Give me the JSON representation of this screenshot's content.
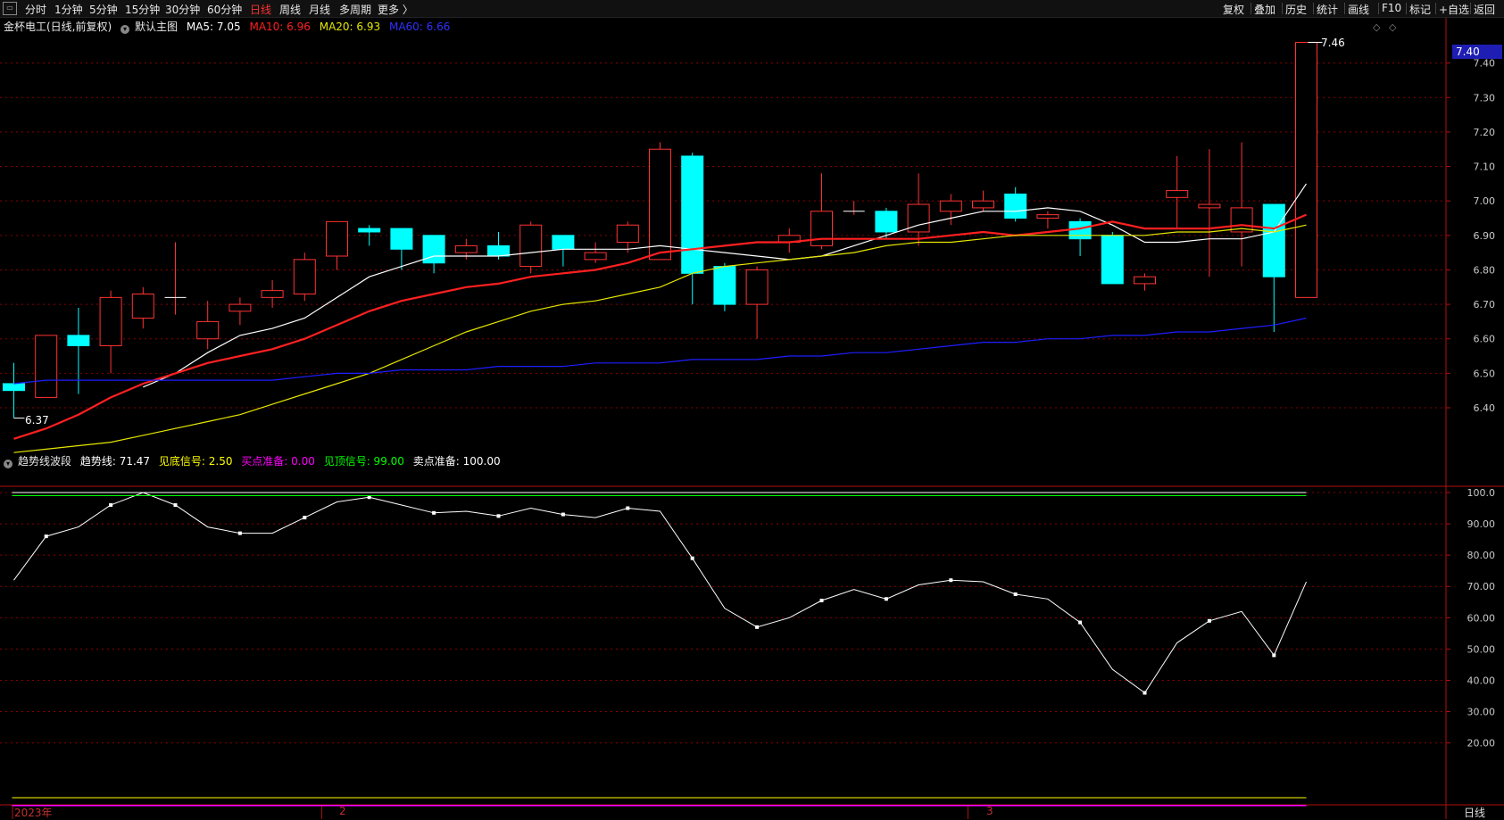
{
  "toolbar": {
    "periods": [
      "分时",
      "1分钟",
      "5分钟",
      "15分钟",
      "30分钟",
      "60分钟",
      "日线",
      "周线",
      "月线",
      "多周期",
      "更多 〉"
    ],
    "active_period": "日线",
    "right_tools": [
      "复权",
      "叠加",
      "历史",
      "统计",
      "画线",
      "F10",
      "标记",
      "+自选",
      "返回"
    ]
  },
  "main_legend": {
    "title": "金杯电工(日线,前复权)",
    "template": "默认主图",
    "ma5": "MA5: 7.05",
    "ma10": "MA10: 6.96",
    "ma20": "MA20: 6.93",
    "ma60": "MA60: 6.66"
  },
  "sub_legend": {
    "name": "趋势线波段",
    "trend": "趋势线: 71.47",
    "bottom_signal": "见底信号: 2.50",
    "buy_prep": "买点准备: 0.00",
    "top_signal": "见顶信号: 99.00",
    "sell_prep": "卖点准备: 100.00"
  },
  "axis": {
    "date_labels": [
      "2023年",
      "2",
      "3"
    ],
    "period_label": "日线",
    "price_badge": "7.40",
    "high_label": "7.46",
    "low_label": "6.37"
  },
  "colors": {
    "up": "#ff3232",
    "down": "#00ffff",
    "ma5": "#ffffff",
    "ma10": "#ff2020",
    "ma20": "#e6e600",
    "ma60": "#1e1eff",
    "grid": "#8b0000",
    "trend": "#ffffff",
    "bottom_signal": "#ffff00",
    "buy_prep": "#ff00ff",
    "top_signal": "#00ff00",
    "sell_prep": "#ffffff"
  },
  "chart_data": [
    {
      "type": "candlestick",
      "ylim": [
        6.18,
        7.5
      ],
      "yticks": [
        "7.40",
        "7.30",
        "7.20",
        "7.10",
        "7.00",
        "6.90",
        "6.80",
        "6.70",
        "6.60",
        "6.50",
        "6.40"
      ],
      "candles": [
        {
          "o": 6.47,
          "h": 6.53,
          "l": 6.37,
          "c": 6.45
        },
        {
          "o": 6.43,
          "h": 6.61,
          "l": 6.43,
          "c": 6.61
        },
        {
          "o": 6.61,
          "h": 6.69,
          "l": 6.44,
          "c": 6.58
        },
        {
          "o": 6.58,
          "h": 6.74,
          "l": 6.5,
          "c": 6.72
        },
        {
          "o": 6.66,
          "h": 6.75,
          "l": 6.63,
          "c": 6.73
        },
        {
          "o": 6.72,
          "h": 6.88,
          "l": 6.67,
          "c": 6.72
        },
        {
          "o": 6.6,
          "h": 6.71,
          "l": 6.57,
          "c": 6.65
        },
        {
          "o": 6.68,
          "h": 6.72,
          "l": 6.64,
          "c": 6.7
        },
        {
          "o": 6.72,
          "h": 6.77,
          "l": 6.69,
          "c": 6.74
        },
        {
          "o": 6.73,
          "h": 6.85,
          "l": 6.71,
          "c": 6.83
        },
        {
          "o": 6.84,
          "h": 6.94,
          "l": 6.8,
          "c": 6.94
        },
        {
          "o": 6.92,
          "h": 6.93,
          "l": 6.87,
          "c": 6.91
        },
        {
          "o": 6.92,
          "h": 6.92,
          "l": 6.8,
          "c": 6.86
        },
        {
          "o": 6.9,
          "h": 6.9,
          "l": 6.79,
          "c": 6.82
        },
        {
          "o": 6.85,
          "h": 6.89,
          "l": 6.83,
          "c": 6.87
        },
        {
          "o": 6.87,
          "h": 6.91,
          "l": 6.83,
          "c": 6.84
        },
        {
          "o": 6.81,
          "h": 6.94,
          "l": 6.79,
          "c": 6.93
        },
        {
          "o": 6.9,
          "h": 6.9,
          "l": 6.81,
          "c": 6.86
        },
        {
          "o": 6.83,
          "h": 6.88,
          "l": 6.82,
          "c": 6.85
        },
        {
          "o": 6.88,
          "h": 6.94,
          "l": 6.85,
          "c": 6.93
        },
        {
          "o": 6.83,
          "h": 7.17,
          "l": 6.83,
          "c": 7.15
        },
        {
          "o": 7.13,
          "h": 7.14,
          "l": 6.7,
          "c": 6.79
        },
        {
          "o": 6.81,
          "h": 6.82,
          "l": 6.68,
          "c": 6.7
        },
        {
          "o": 6.7,
          "h": 6.81,
          "l": 6.6,
          "c": 6.8
        },
        {
          "o": 6.88,
          "h": 6.92,
          "l": 6.85,
          "c": 6.9
        },
        {
          "o": 6.87,
          "h": 7.08,
          "l": 6.86,
          "c": 6.97
        },
        {
          "o": 6.97,
          "h": 7.0,
          "l": 6.96,
          "c": 6.97
        },
        {
          "o": 6.97,
          "h": 6.98,
          "l": 6.89,
          "c": 6.91
        },
        {
          "o": 6.91,
          "h": 7.08,
          "l": 6.87,
          "c": 6.99
        },
        {
          "o": 6.97,
          "h": 7.02,
          "l": 6.93,
          "c": 7.0
        },
        {
          "o": 6.98,
          "h": 7.03,
          "l": 6.97,
          "c": 7.0
        },
        {
          "o": 7.02,
          "h": 7.04,
          "l": 6.94,
          "c": 6.95
        },
        {
          "o": 6.95,
          "h": 6.97,
          "l": 6.92,
          "c": 6.96
        },
        {
          "o": 6.94,
          "h": 6.95,
          "l": 6.84,
          "c": 6.89
        },
        {
          "o": 6.9,
          "h": 6.91,
          "l": 6.76,
          "c": 6.76
        },
        {
          "o": 6.76,
          "h": 6.79,
          "l": 6.74,
          "c": 6.78
        },
        {
          "o": 7.01,
          "h": 7.13,
          "l": 6.92,
          "c": 7.03
        },
        {
          "o": 6.98,
          "h": 7.15,
          "l": 6.78,
          "c": 6.99
        },
        {
          "o": 6.91,
          "h": 7.17,
          "l": 6.81,
          "c": 6.98
        },
        {
          "o": 6.99,
          "h": 6.99,
          "l": 6.62,
          "c": 6.78
        },
        {
          "o": 6.72,
          "h": 7.46,
          "l": 6.72,
          "c": 7.46
        }
      ],
      "series": [
        {
          "name": "MA5",
          "values": [
            null,
            null,
            null,
            null,
            6.46,
            6.5,
            6.56,
            6.61,
            6.63,
            6.66,
            6.72,
            6.78,
            6.81,
            6.84,
            6.84,
            6.84,
            6.85,
            6.86,
            6.86,
            6.86,
            6.87,
            6.86,
            6.85,
            6.84,
            6.83,
            6.84,
            6.87,
            6.9,
            6.93,
            6.95,
            6.97,
            6.97,
            6.98,
            6.97,
            6.93,
            6.88,
            6.88,
            6.89,
            6.89,
            6.91,
            7.05
          ]
        },
        {
          "name": "MA10",
          "values": [
            6.31,
            6.34,
            6.38,
            6.43,
            6.47,
            6.5,
            6.53,
            6.55,
            6.57,
            6.6,
            6.64,
            6.68,
            6.71,
            6.73,
            6.75,
            6.76,
            6.78,
            6.79,
            6.8,
            6.82,
            6.85,
            6.86,
            6.87,
            6.88,
            6.88,
            6.89,
            6.89,
            6.89,
            6.89,
            6.9,
            6.91,
            6.9,
            6.91,
            6.92,
            6.94,
            6.92,
            6.92,
            6.92,
            6.93,
            6.92,
            6.96
          ]
        },
        {
          "name": "MA20",
          "values": [
            6.27,
            6.28,
            6.29,
            6.3,
            6.32,
            6.34,
            6.36,
            6.38,
            6.41,
            6.44,
            6.47,
            6.5,
            6.54,
            6.58,
            6.62,
            6.65,
            6.68,
            6.7,
            6.71,
            6.73,
            6.75,
            6.79,
            6.81,
            6.82,
            6.83,
            6.84,
            6.85,
            6.87,
            6.88,
            6.88,
            6.89,
            6.9,
            6.9,
            6.9,
            6.9,
            6.9,
            6.91,
            6.91,
            6.92,
            6.91,
            6.93
          ]
        },
        {
          "name": "MA60",
          "values": [
            6.47,
            6.48,
            6.48,
            6.48,
            6.48,
            6.48,
            6.48,
            6.48,
            6.48,
            6.49,
            6.5,
            6.5,
            6.51,
            6.51,
            6.51,
            6.52,
            6.52,
            6.52,
            6.53,
            6.53,
            6.53,
            6.54,
            6.54,
            6.54,
            6.55,
            6.55,
            6.56,
            6.56,
            6.57,
            6.58,
            6.59,
            6.59,
            6.6,
            6.6,
            6.61,
            6.61,
            6.62,
            6.62,
            6.63,
            6.64,
            6.66
          ]
        }
      ]
    },
    {
      "type": "line",
      "ylim": [
        2.5,
        100
      ],
      "yticks": [
        "100.0",
        "90.00",
        "80.00",
        "70.00",
        "60.00",
        "50.00",
        "40.00",
        "30.00",
        "20.00"
      ],
      "series": [
        {
          "name": "趋势线",
          "values": [
            72,
            86,
            89,
            96,
            100,
            96,
            89,
            87,
            87,
            92,
            97,
            98.5,
            96,
            93.5,
            94,
            92.5,
            95,
            93,
            92,
            95,
            94,
            79,
            63,
            57,
            60,
            65.5,
            69,
            66,
            70.5,
            72,
            71.5,
            67.5,
            66,
            58.5,
            43.5,
            36,
            52,
            59,
            62,
            48,
            71.47
          ]
        },
        {
          "name": "见底信号",
          "values": [
            2.5
          ]
        },
        {
          "name": "买点准备",
          "values": [
            0.0
          ]
        },
        {
          "name": "见顶信号",
          "values": [
            99.0
          ]
        },
        {
          "name": "卖点准备",
          "values": [
            100.0
          ]
        }
      ]
    }
  ]
}
